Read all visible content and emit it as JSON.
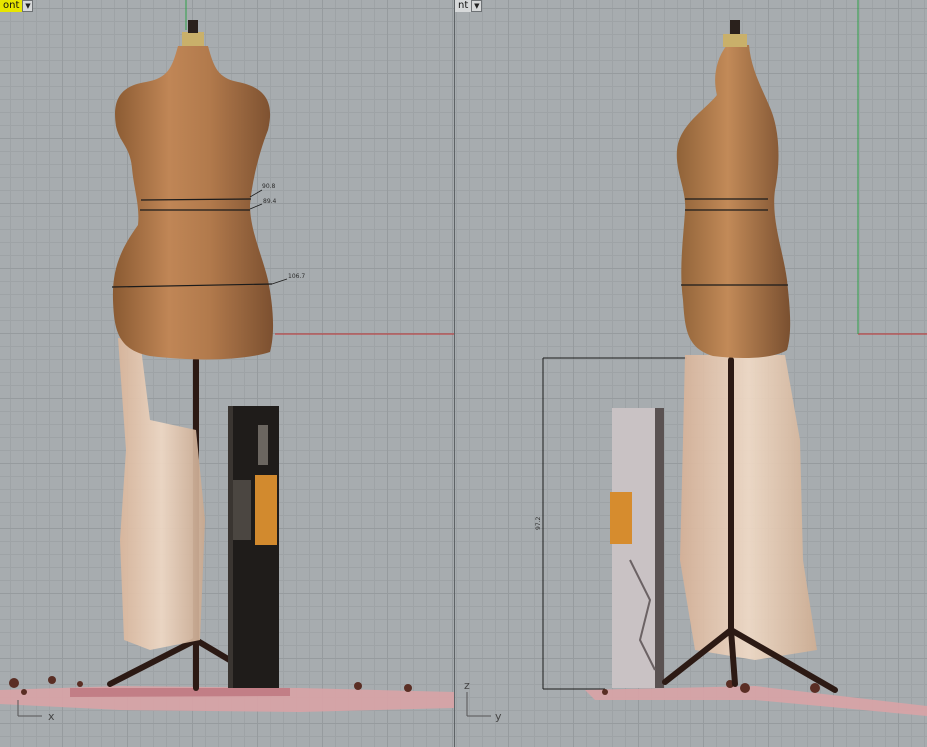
{
  "viewports": {
    "front": {
      "label": "ont",
      "axes": {
        "horizontal": "x",
        "vertical": ""
      }
    },
    "right": {
      "label": "nt",
      "axes": {
        "horizontal": "y",
        "vertical": "z"
      }
    }
  },
  "dimensions": {
    "front": [
      "90.8",
      "89.4",
      "106.7"
    ],
    "right_height": "97.2"
  },
  "colors": {
    "grid_background": "#a7acaf",
    "active_viewport_label": "#e8e600",
    "x_axis": "#c03030",
    "y_axis": "#2fa24a"
  }
}
